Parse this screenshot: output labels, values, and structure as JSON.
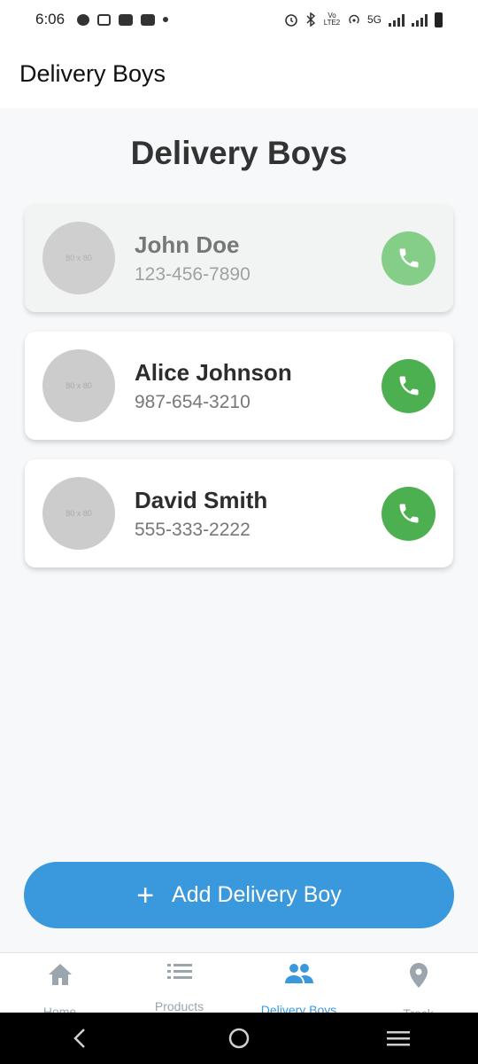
{
  "status_bar": {
    "time": "6:06",
    "network_label": "5G",
    "volte_label": "Vo LTE2"
  },
  "app_bar": {
    "title": "Delivery Boys"
  },
  "main": {
    "heading": "Delivery Boys",
    "avatar_placeholder": "80 x 80",
    "delivery_boys": [
      {
        "name": "John Doe",
        "phone": "123-456-7890"
      },
      {
        "name": "Alice Johnson",
        "phone": "987-654-3210"
      },
      {
        "name": "David Smith",
        "phone": "555-333-2222"
      }
    ],
    "add_button_label": "Add Delivery Boy",
    "add_button_icon": "plus-icon"
  },
  "bottom_nav": {
    "items": [
      {
        "label": "Home",
        "icon": "home-icon"
      },
      {
        "label": "Products",
        "icon": "list-icon"
      },
      {
        "label": "Delivery Boys",
        "icon": "people-icon"
      },
      {
        "label": "Track",
        "icon": "location-pin-icon"
      }
    ],
    "active_index": 2
  },
  "colors": {
    "accent": "#3a98dc",
    "call": "#4caf50",
    "nav_inactive": "#9aa5ae"
  }
}
